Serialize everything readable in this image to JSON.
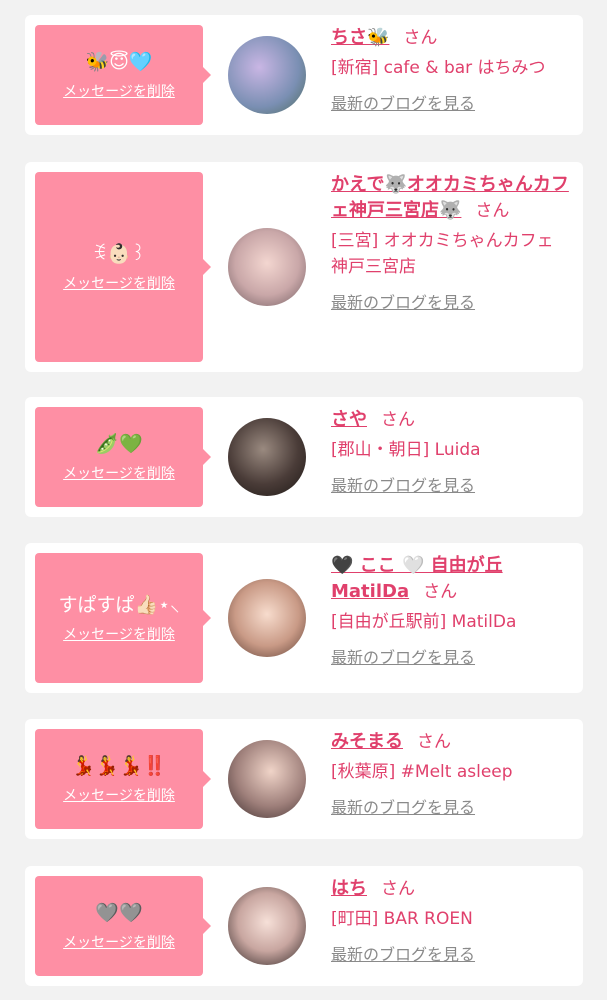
{
  "colors": {
    "accent": "#e0406c",
    "bubble": "#fe8fa4",
    "link_gray": "#8a8a8a",
    "background": "#f2f2f2"
  },
  "delete_label": "メッセージを削除",
  "honorific": "さん",
  "blog_label": "最新のブログを見る",
  "entries": [
    {
      "message": "🐝😇🩵",
      "name": "ちさ🐝",
      "shop": "[新宿] cafe & bar はちみつ"
    },
    {
      "message": "ꉂ👶🏻꒱",
      "name": "かえで🐺オオカミちゃんカフェ神戸三宮店🐺",
      "shop": "[三宮] オオカミちゃんカフェ神戸三宮店"
    },
    {
      "message": "🫛💚",
      "name": "さや",
      "shop": "[郡山・朝日] Luida"
    },
    {
      "message": "すぱすぱ👍🏻⋆⸜",
      "name": "🖤 ここ 🤍 自由が丘MatilDa",
      "shop": "[自由が丘駅前] MatilDa"
    },
    {
      "message": "💃💃💃‼️",
      "name": "みそまる",
      "shop": "[秋葉原] #Melt asleep"
    },
    {
      "message": "🩶🩶",
      "name": "はち",
      "shop": "[町田] BAR ROEN"
    }
  ]
}
